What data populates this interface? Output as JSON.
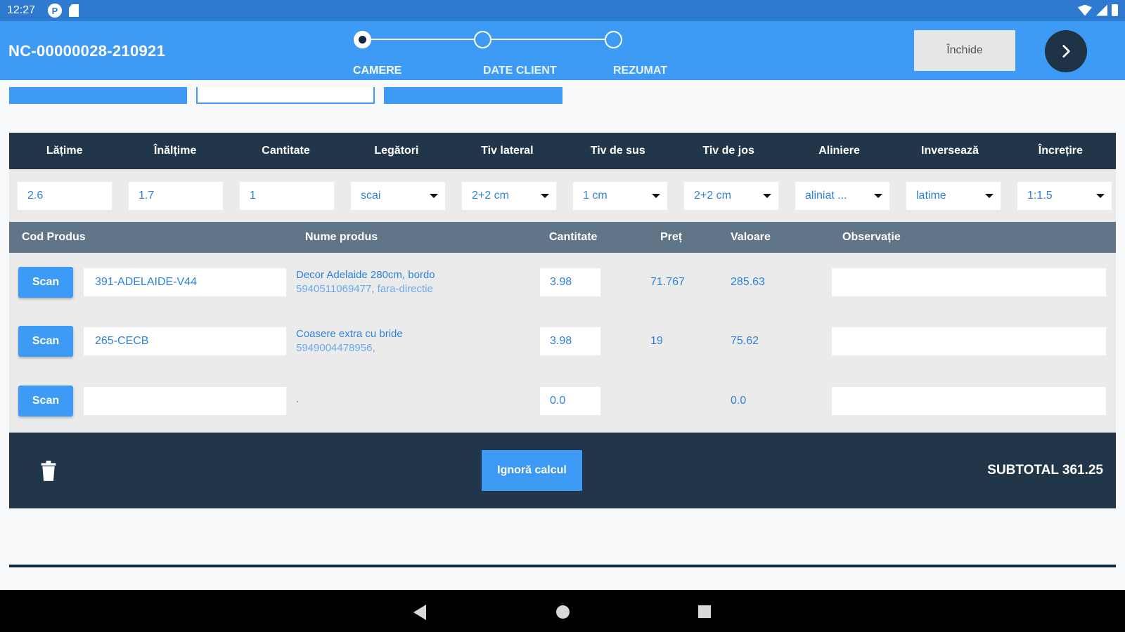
{
  "status_bar": {
    "time": "12:27",
    "icons": [
      "p-app-icon",
      "sd-card-icon",
      "wifi-icon",
      "signal-icon",
      "battery-icon"
    ],
    "p_icon_glyph": "P"
  },
  "header": {
    "title": "NC-00000028-210921",
    "steps": [
      {
        "label": "CAMERE",
        "active": true
      },
      {
        "label": "DATE CLIENT",
        "active": false
      },
      {
        "label": "REZUMAT",
        "active": false
      }
    ],
    "close_label": "Închide"
  },
  "dimensions": {
    "headers": [
      "Lățime",
      "Înălțime",
      "Cantitate",
      "Legători",
      "Tiv lateral",
      "Tiv de sus",
      "Tiv de jos",
      "Aliniere",
      "Inversează",
      "Încrețire"
    ],
    "values": [
      "2.6",
      "1.7",
      "1",
      "scai",
      "2+2 cm",
      "1 cm",
      "2+2 cm",
      "aliniat ...",
      "latime",
      "1:1.5"
    ]
  },
  "products": {
    "headers": {
      "code": "Cod Produs",
      "name": "Nume produs",
      "qty": "Cantitate",
      "price": "Preț",
      "value": "Valoare",
      "notes": "Observație"
    },
    "scan_label": "Scan",
    "rows": [
      {
        "code": "391-ADELAIDE-V44",
        "name": "Decor Adelaide 280cm, bordo",
        "sub": "5940511069477, fara-directie",
        "qty": "3.98",
        "price": "71.767",
        "value": "285.63",
        "notes": ""
      },
      {
        "code": "265-CECB",
        "name": "Coasere extra cu bride",
        "sub": "5949004478956,",
        "qty": "3.98",
        "price": "19",
        "value": "75.62",
        "notes": ""
      },
      {
        "code": "",
        "name": ".",
        "sub": "",
        "qty": "0.0",
        "price": "",
        "value": "0.0",
        "notes": ""
      }
    ]
  },
  "footer": {
    "ignore_label": "Ignoră calcul",
    "subtotal": "SUBTOTAL 361.25"
  },
  "colors": {
    "accent": "#3d9bf5",
    "status_bar": "#2f7ad1",
    "dark": "#22364a",
    "subheader": "#617588",
    "text_blue": "#2f82dc"
  }
}
